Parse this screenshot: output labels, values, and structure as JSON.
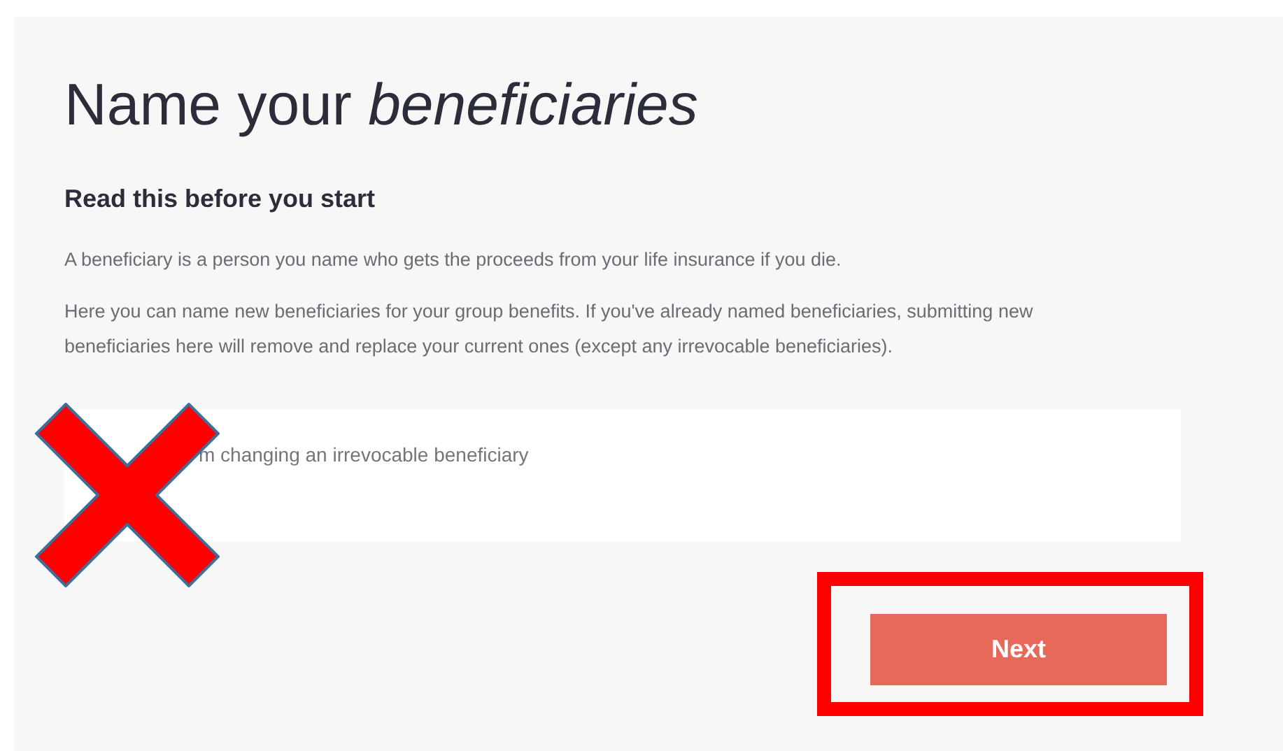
{
  "title": "Name your *beneficiaries*",
  "section": {
    "heading": "Read this before you start",
    "paragraphs": [
      "A beneficiary is a person you name who gets the proceeds from your life insurance if you die.",
      "Here you can name new beneficiaries for your group benefits. If you've already named beneficiaries, submitting new beneficiaries here will remove and replace your current ones (except any irrevocable beneficiaries)."
    ]
  },
  "option": {
    "label": "m changing an irrevocable beneficiary"
  },
  "buttons": [
    "Next"
  ]
}
